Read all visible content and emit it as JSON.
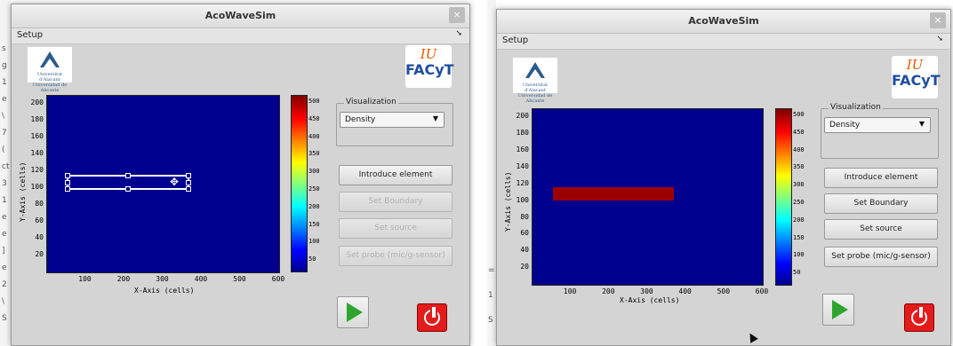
{
  "background": {
    "left_fragments": [
      "s",
      "g",
      "1",
      "e",
      "\\",
      "7",
      "(",
      "ct",
      "3",
      "1",
      "e",
      "e",
      "]",
      "e",
      "2",
      "\\",
      "S"
    ],
    "mid_fragments": [
      "=",
      "1",
      "S"
    ]
  },
  "window_left": {
    "title": "AcoWaveSim",
    "close_label": "×",
    "menu": {
      "setup_label": "Setup",
      "overflow": "➘"
    },
    "logo_ua_text": "Universitat d'Alacant Universidad de Alicante",
    "logo_iu": "IU",
    "logo_facyt": "FACyT",
    "plot": {
      "y_ticks": [
        "200",
        "180",
        "160",
        "140",
        "120",
        "100",
        "80",
        "60",
        "40",
        "20"
      ],
      "x_ticks": [
        "100",
        "200",
        "300",
        "400",
        "500",
        "600"
      ],
      "xlabel": "X-Axis (cells)",
      "ylabel": "Y-Axis (cells)"
    },
    "colorbar_ticks": [
      "500",
      "450",
      "400",
      "350",
      "300",
      "250",
      "200",
      "150",
      "100",
      "50"
    ],
    "visualization": {
      "label": "Visualization",
      "selected": "Density"
    },
    "buttons": {
      "introduce": "Introduce element",
      "boundary": "Set Boundary",
      "source": "Set source",
      "probe": "Set probe (mic/g-sensor)"
    }
  },
  "window_right": {
    "title": "AcoWaveSim",
    "close_label": "×",
    "menu": {
      "setup_label": "Setup",
      "overflow": "➘"
    },
    "logo_ua_text": "Universitat d'Alacant Universidad de Alicante",
    "logo_iu": "IU",
    "logo_facyt": "FACyT",
    "plot": {
      "y_ticks": [
        "200",
        "180",
        "160",
        "140",
        "120",
        "100",
        "80",
        "60",
        "40",
        "20"
      ],
      "x_ticks": [
        "100",
        "200",
        "300",
        "400",
        "500",
        "600"
      ],
      "xlabel": "X-Axis (cells)",
      "ylabel": "Y-Axis (cells)"
    },
    "colorbar_ticks": [
      "500",
      "450",
      "400",
      "350",
      "300",
      "250",
      "200",
      "150",
      "100",
      "50"
    ],
    "visualization": {
      "label": "Visualization",
      "selected": "Density"
    },
    "buttons": {
      "introduce": "Introduce element",
      "boundary": "Set Boundary",
      "source": "Set source",
      "probe": "Set probe (mic/g-sensor)"
    }
  },
  "colors": {
    "plot_bg": "#00008f",
    "element": "#9c0000",
    "play": "#2fa52f",
    "power": "#e31b1b"
  }
}
